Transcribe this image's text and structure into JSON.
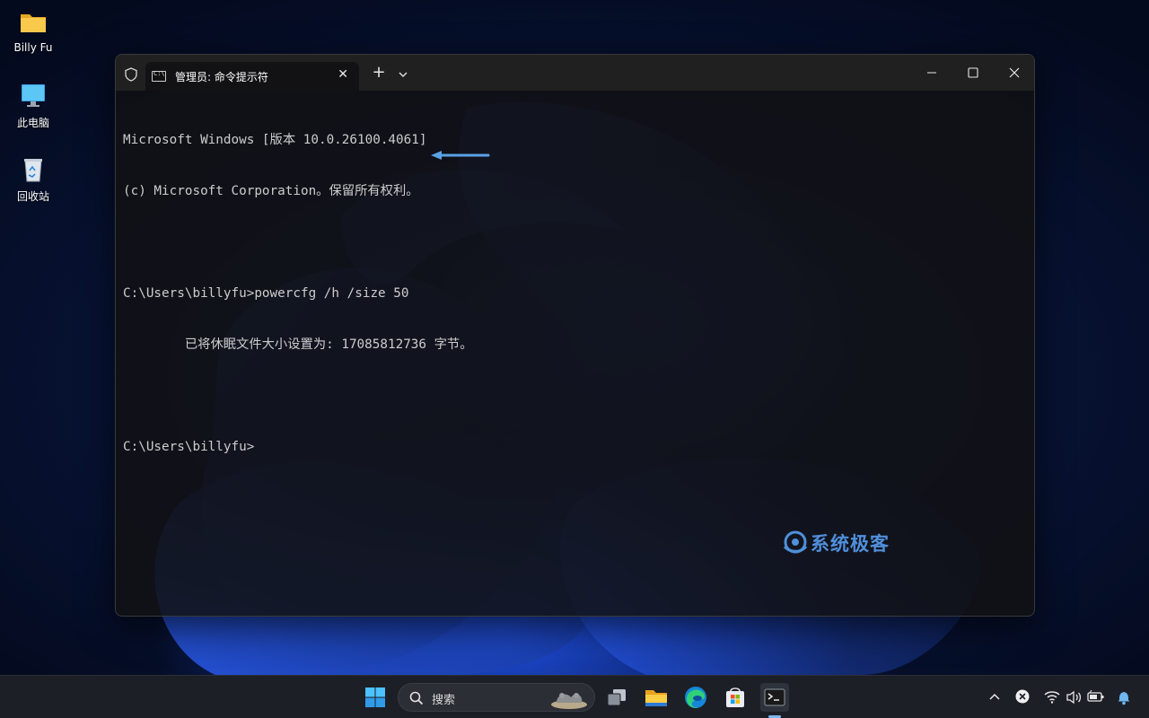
{
  "desktop": {
    "icons": [
      {
        "label": "Billy Fu",
        "icon": "folder-icon"
      },
      {
        "label": "此电脑",
        "icon": "computer-icon"
      },
      {
        "label": "回收站",
        "icon": "recycle-bin-icon"
      }
    ]
  },
  "terminal": {
    "tab_title": "管理员: 命令提示符",
    "lines": [
      "Microsoft Windows [版本 10.0.26100.4061]",
      "(c) Microsoft Corporation。保留所有权利。",
      "",
      "C:\\Users\\billyfu>powercfg /h /size 50",
      "        已将休眠文件大小设置为: 17085812736 字节。",
      "",
      "C:\\Users\\billyfu>"
    ],
    "arrow_color": "#5aa2e6"
  },
  "watermark": {
    "text": "系统极客"
  },
  "taskbar": {
    "search_label": "搜索",
    "pinned": [
      "windows-start-icon",
      "task-view-icon",
      "file-explorer-icon",
      "edge-icon",
      "store-icon",
      "terminal-icon"
    ],
    "tray": [
      "chevron-up-icon",
      "close-circle-icon",
      "wifi-icon",
      "speaker-icon",
      "battery-icon",
      "notification-bell-icon"
    ]
  },
  "colors": {
    "accent": "#4f8fdb",
    "console_text": "#cccccc",
    "taskbar_bg": "#1c1f26"
  }
}
